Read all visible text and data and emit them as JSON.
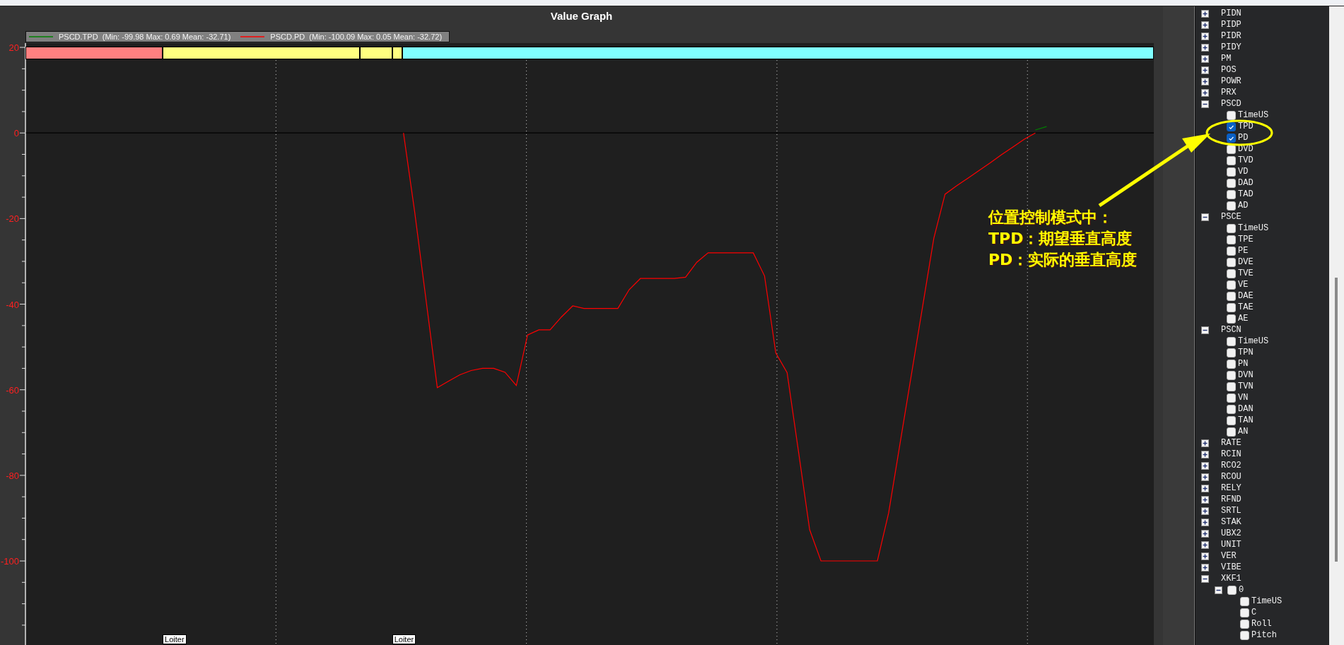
{
  "graph": {
    "title": "Value Graph",
    "legend_stats": [
      "(Min: -99.98 Max: 0.69 Mean: -32.71)",
      "(Min: -100.09 Max: 0.05 Mean: -32.72)"
    ],
    "mode_bands": [
      {
        "color": "#ff8080"
      },
      {
        "color": "#ffff80"
      },
      {
        "color": "#ffff80"
      },
      {
        "color": "#ffff80"
      },
      {
        "color": "#80ffff"
      }
    ],
    "mode_markers": [
      {
        "label": "Loiter"
      },
      {
        "label": "Loiter"
      }
    ],
    "chart_data": {
      "type": "line",
      "ylim": [
        -119.8,
        21
      ],
      "yticks": [
        {
          "value": 20,
          "label": "20"
        },
        {
          "value": 0,
          "label": "0"
        },
        {
          "value": -20,
          "label": "-20"
        },
        {
          "value": -40,
          "label": "-40"
        },
        {
          "value": -60,
          "label": "-60"
        },
        {
          "value": -80,
          "label": "-80"
        },
        {
          "value": -100,
          "label": "-100"
        }
      ],
      "categories": [
        null,
        null,
        null,
        null,
        null,
        null,
        null,
        null,
        null,
        null,
        null,
        null,
        null,
        null,
        null,
        null,
        null,
        null,
        null,
        null,
        null,
        null,
        null,
        null,
        null,
        null,
        null,
        null,
        null,
        null,
        null,
        null,
        null,
        null,
        null,
        null,
        null,
        null,
        null,
        null,
        null,
        null,
        null,
        null,
        null,
        null,
        null,
        null,
        null,
        null,
        null,
        null,
        null,
        null,
        null,
        null,
        null,
        null,
        null,
        null,
        null,
        null,
        null,
        null,
        null,
        null,
        null,
        null,
        null,
        null,
        null,
        null,
        null,
        null,
        null,
        null,
        null,
        null,
        null,
        null,
        null,
        null,
        null,
        null,
        null,
        null,
        null,
        null,
        null,
        null,
        null,
        null,
        null,
        null,
        null,
        null,
        null,
        null,
        null,
        null
      ],
      "series": [
        {
          "name": "PSCD.TPD",
          "color": "#008000",
          "values": [
            null,
            null,
            null,
            null,
            null,
            null,
            null,
            null,
            null,
            null,
            null,
            null,
            null,
            null,
            null,
            null,
            null,
            null,
            null,
            null,
            null,
            null,
            null,
            null,
            null,
            null,
            null,
            null,
            null,
            null,
            null,
            null,
            null,
            null,
            null,
            null,
            null,
            null,
            null,
            null,
            null,
            null,
            null,
            null,
            null,
            null,
            null,
            null,
            null,
            null,
            null,
            null,
            null,
            null,
            null,
            null,
            null,
            null,
            null,
            null,
            null,
            null,
            null,
            null,
            null,
            null,
            null,
            null,
            null,
            null,
            null,
            null,
            null,
            null,
            null,
            null,
            null,
            null,
            null,
            null,
            null,
            null,
            null,
            null,
            null,
            null,
            null,
            null,
            null,
            0.7,
            1.5,
            null,
            null,
            null,
            null,
            null,
            null,
            null,
            null,
            null
          ]
        },
        {
          "name": "PSCD.PD",
          "color": "#ff0000",
          "values": [
            null,
            null,
            null,
            null,
            null,
            null,
            null,
            null,
            null,
            null,
            null,
            null,
            null,
            null,
            null,
            null,
            null,
            null,
            null,
            null,
            null,
            null,
            null,
            null,
            null,
            null,
            null,
            null,
            null,
            null,
            null,
            null,
            null,
            0,
            -18.5,
            -39,
            -59.5,
            -58,
            -56.5,
            -55.5,
            -55,
            -55,
            -55.9,
            -59,
            -47.2,
            -46,
            -46,
            -43,
            -40.4,
            -41,
            -41,
            -41,
            -41,
            -36.6,
            -34,
            -34,
            -34,
            -34,
            -33.7,
            -30.2,
            -28,
            -28,
            -28,
            -28,
            -28,
            -33.4,
            -51.4,
            -56,
            -74.3,
            -92.7,
            -100,
            -100,
            -100,
            -100,
            -100,
            -100,
            -88.8,
            -72.7,
            -56.7,
            -40.7,
            -24.6,
            -14.3,
            -12.4,
            -10.6,
            -8.8,
            -7,
            -5.1,
            -3.3,
            -1.5,
            0,
            null,
            null,
            null,
            null,
            null,
            null,
            null,
            null,
            null,
            null
          ]
        }
      ]
    }
  },
  "tree": [
    {
      "label": "PIDN",
      "expanded": false
    },
    {
      "label": "PIDP",
      "expanded": false
    },
    {
      "label": "PIDR",
      "expanded": false
    },
    {
      "label": "PIDY",
      "expanded": false
    },
    {
      "label": "PM",
      "expanded": false
    },
    {
      "label": "POS",
      "expanded": false
    },
    {
      "label": "POWR",
      "expanded": false
    },
    {
      "label": "PRX",
      "expanded": false
    },
    {
      "label": "PSCD",
      "expanded": true,
      "children": [
        {
          "label": "TimeUS",
          "checked": false
        },
        {
          "label": "TPD",
          "checked": true
        },
        {
          "label": "PD",
          "checked": true
        },
        {
          "label": "DVD",
          "checked": false
        },
        {
          "label": "TVD",
          "checked": false
        },
        {
          "label": "VD",
          "checked": false
        },
        {
          "label": "DAD",
          "checked": false
        },
        {
          "label": "TAD",
          "checked": false
        },
        {
          "label": "AD",
          "checked": false
        }
      ]
    },
    {
      "label": "PSCE",
      "expanded": true,
      "children": [
        {
          "label": "TimeUS",
          "checked": false
        },
        {
          "label": "TPE",
          "checked": false
        },
        {
          "label": "PE",
          "checked": false
        },
        {
          "label": "DVE",
          "checked": false
        },
        {
          "label": "TVE",
          "checked": false
        },
        {
          "label": "VE",
          "checked": false
        },
        {
          "label": "DAE",
          "checked": false
        },
        {
          "label": "TAE",
          "checked": false
        },
        {
          "label": "AE",
          "checked": false
        }
      ]
    },
    {
      "label": "PSCN",
      "expanded": true,
      "children": [
        {
          "label": "TimeUS",
          "checked": false
        },
        {
          "label": "TPN",
          "checked": false
        },
        {
          "label": "PN",
          "checked": false
        },
        {
          "label": "DVN",
          "checked": false
        },
        {
          "label": "TVN",
          "checked": false
        },
        {
          "label": "VN",
          "checked": false
        },
        {
          "label": "DAN",
          "checked": false
        },
        {
          "label": "TAN",
          "checked": false
        },
        {
          "label": "AN",
          "checked": false
        }
      ]
    },
    {
      "label": "RATE",
      "expanded": false
    },
    {
      "label": "RCIN",
      "expanded": false
    },
    {
      "label": "RCO2",
      "expanded": false
    },
    {
      "label": "RCOU",
      "expanded": false
    },
    {
      "label": "RELY",
      "expanded": false
    },
    {
      "label": "RFND",
      "expanded": false
    },
    {
      "label": "SRTL",
      "expanded": false
    },
    {
      "label": "STAK",
      "expanded": false
    },
    {
      "label": "UBX2",
      "expanded": false
    },
    {
      "label": "UNIT",
      "expanded": false
    },
    {
      "label": "VER",
      "expanded": false
    },
    {
      "label": "VIBE",
      "expanded": false
    },
    {
      "label": "XKF1",
      "expanded": true,
      "children": [
        {
          "label": "0",
          "expanded": true,
          "checked": false,
          "children": [
            {
              "label": "TimeUS",
              "checked": false
            },
            {
              "label": "C",
              "checked": false
            },
            {
              "label": "Roll",
              "checked": false
            },
            {
              "label": "Pitch",
              "checked": false
            }
          ]
        }
      ]
    }
  ],
  "annotation": {
    "lines": [
      "位置控制模式中：",
      "TPD：期望垂直高度",
      "PD：实际的垂直高度"
    ]
  }
}
